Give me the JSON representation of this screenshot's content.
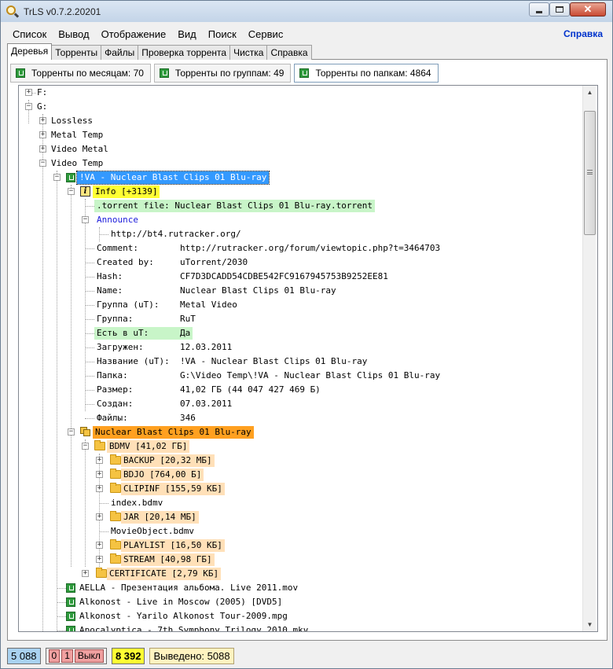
{
  "window": {
    "title": "TrLS v0.7.2.20201"
  },
  "menu": {
    "items": [
      "Список",
      "Вывод",
      "Отображение",
      "Вид",
      "Поиск",
      "Сервис"
    ],
    "help": "Справка"
  },
  "tabs": [
    "Деревья",
    "Торренты",
    "Файлы",
    "Проверка торрента",
    "Чистка",
    "Справка"
  ],
  "subtabs": [
    "Торренты по месяцам: 70",
    "Торренты по группам: 49",
    "Торренты по папкам: 4864"
  ],
  "tree": {
    "drive_f": "F:",
    "drive_g": "G:",
    "folders": [
      "Lossless",
      "Metal Temp",
      "Video Metal",
      "Video Temp"
    ],
    "selected": "!VA - Nuclear Blast Clips 01 Blu-ray",
    "info": "Info [+3139]",
    "torrent_file": ".torrent file: Nuclear Blast Clips 01 Blu-ray.torrent",
    "announce": "Announce",
    "announce_url": "http://bt4.rutracker.org/",
    "fields": [
      {
        "key": "Comment:",
        "value": "http://rutracker.org/forum/viewtopic.php?t=3464703"
      },
      {
        "key": "Created by:",
        "value": "uTorrent/2030"
      },
      {
        "key": "Hash:",
        "value": "CF7D3DCADD54CDBE542FC9167945753B9252EE81"
      },
      {
        "key": "Name:",
        "value": "Nuclear Blast Clips 01 Blu-ray"
      },
      {
        "key": "Группа (uT):",
        "value": "Metal Video"
      },
      {
        "key": "Группа:",
        "value": "RuT"
      },
      {
        "key": "Есть в uT:",
        "value": "Да"
      },
      {
        "key": "Загружен:",
        "value": "12.03.2011"
      },
      {
        "key": "Название (uT):",
        "value": "!VA - Nuclear Blast Clips 01 Blu-ray"
      },
      {
        "key": "Папка:",
        "value": "G:\\Video Temp\\!VA - Nuclear Blast Clips 01 Blu-ray"
      },
      {
        "key": "Размер:",
        "value": "41,02 ГБ (44 047 427 469 Б)"
      },
      {
        "key": "Создан:",
        "value": "07.03.2011"
      },
      {
        "key": "Файлы:",
        "value": "346"
      }
    ],
    "content_root": "Nuclear Blast Clips 01 Blu-ray",
    "bdmv": "BDMV [41,02 ГБ]",
    "bdmv_children": [
      {
        "label": "BACKUP [20,32 МБ]",
        "folder": true
      },
      {
        "label": "BDJO [764,00 Б]",
        "folder": true
      },
      {
        "label": "CLIPINF [155,59 КБ]",
        "folder": true
      },
      {
        "label": "index.bdmv",
        "folder": false
      },
      {
        "label": "JAR [20,14 МБ]",
        "folder": true
      },
      {
        "label": "MovieObject.bdmv",
        "folder": false
      },
      {
        "label": "PLAYLIST [16,50 КБ]",
        "folder": true
      },
      {
        "label": "STREAM [40,98 ГБ]",
        "folder": true
      }
    ],
    "certificate": "CERTIFICATE [2,79 КБ]",
    "torrents": [
      "AELLA - Презентация альбома. Live 2011.mov",
      "Alkonost - Live in Moscow (2005) [DVD5]",
      "Alkonost - Yarilo Alkonost Tour-2009.mpg",
      "Apocalyptica - 7th Symphony Trilogy 2010.mkv"
    ]
  },
  "status": {
    "total": "5 088",
    "red1": "0",
    "red2": "1",
    "off": "Выкл",
    "yellow": "8 392",
    "shown": "Выведено: 5088"
  },
  "colors": {
    "selection": "#3399ff",
    "info": "#ffff33",
    "green": "#c8f5c8",
    "orange": "#ffa020",
    "peach": "#ffe0b8",
    "help_link": "#0033cc"
  }
}
